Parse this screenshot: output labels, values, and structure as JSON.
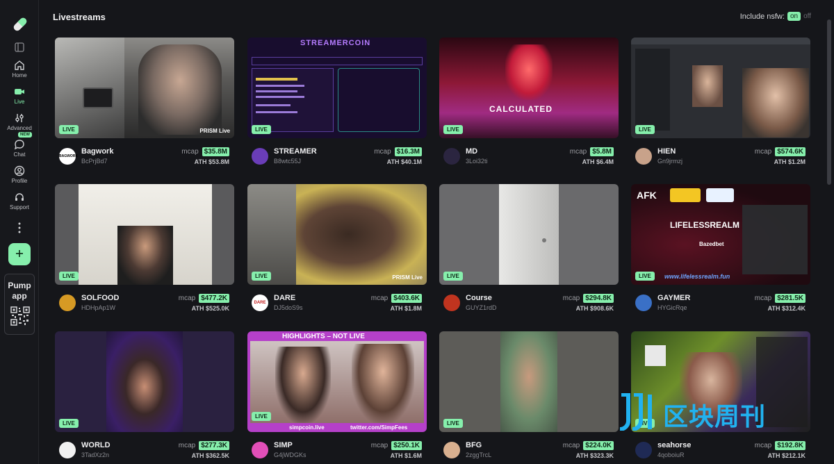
{
  "header": {
    "title": "Livestreams",
    "nsfw_label": "Include nsfw:",
    "nsfw_on": "on",
    "nsfw_off": "off"
  },
  "nav": {
    "home": "Home",
    "live": "Live",
    "advanced": "Advanced",
    "chat": "Chat",
    "chat_badge": "NEW",
    "profile": "Profile",
    "support": "Support",
    "pump_app": "Pump app"
  },
  "labels": {
    "mcap": "mcap",
    "live": "LIVE",
    "ath_prefix": "ATH"
  },
  "colors": {
    "accent": "#86efac",
    "background": "#15161a"
  },
  "thumb_text": {
    "prism1": "PRISM Live",
    "prism2": "PRISM Live",
    "streamercoin": "STREAMERCOIN",
    "calculated": "CALCULATED",
    "highlights": "HIGHLIGHTS – NOT LIVE",
    "simp_url": "simpcoin.live",
    "simp_tw": "twitter.com/SimpFees",
    "afk": "AFK",
    "lifeless": "LIFELESSREALM",
    "lifeless_url": "www.lifelessrealm.fun",
    "bazedbet": "Bazedbet"
  },
  "cards": [
    {
      "name": "Bagwork",
      "address": "BcPrjBd7",
      "mcap": "$35.8M",
      "ath": "$53.8M",
      "avatar": "BAGWORK"
    },
    {
      "name": "STREAMER",
      "address": "B8wtc55J",
      "mcap": "$16.3M",
      "ath": "$40.1M",
      "avatar": ""
    },
    {
      "name": "MD",
      "address": "3Loi32ti",
      "mcap": "$5.8M",
      "ath": "$6.4M",
      "avatar": ""
    },
    {
      "name": "HIEN",
      "address": "Gn9jrmzj",
      "mcap": "$574.6K",
      "ath": "$1.2M",
      "avatar": ""
    },
    {
      "name": "SOLFOOD",
      "address": "HDHpAp1W",
      "mcap": "$477.2K",
      "ath": "$525.0K",
      "avatar": ""
    },
    {
      "name": "DARE",
      "address": "DJ5doS9s",
      "mcap": "$403.6K",
      "ath": "$1.8M",
      "avatar": "DARE"
    },
    {
      "name": "Course",
      "address": "GUYZ1rdD",
      "mcap": "$294.8K",
      "ath": "$908.6K",
      "avatar": ""
    },
    {
      "name": "GAYMER",
      "address": "HYGicRqe",
      "mcap": "$281.5K",
      "ath": "$312.4K",
      "avatar": ""
    },
    {
      "name": "WORLD",
      "address": "3TadXz2n",
      "mcap": "$277.3K",
      "ath": "$362.5K",
      "avatar": ""
    },
    {
      "name": "SIMP",
      "address": "G4jWDGKs",
      "mcap": "$250.1K",
      "ath": "$1.6M",
      "avatar": ""
    },
    {
      "name": "BFG",
      "address": "2zggTrcL",
      "mcap": "$224.0K",
      "ath": "$323.3K",
      "avatar": ""
    },
    {
      "name": "seahorse",
      "address": "4qoboiuR",
      "mcap": "$192.8K",
      "ath": "$212.1K",
      "avatar": ""
    }
  ],
  "watermark": "区块周刊"
}
